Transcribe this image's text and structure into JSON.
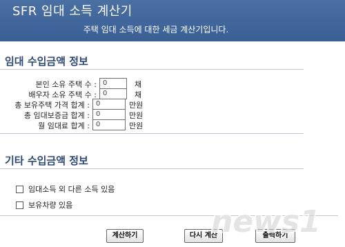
{
  "header": {
    "title": "SFR 임대 소득 계산기",
    "subtitle": "주택 임대 소득에 대한 세금 계산기입니다."
  },
  "section1": {
    "title": "임대 수입금액 정보",
    "rows": [
      {
        "label": "본인 소유 주택 수 :",
        "value": "0",
        "unit": "채"
      },
      {
        "label": "배우자 소유 주택 수 :",
        "value": "0",
        "unit": "채"
      },
      {
        "label": "총 보유주택 가격 합계 :",
        "value": "0",
        "unit": "만원"
      },
      {
        "label": "총 임대보증금 합계 :",
        "value": "0",
        "unit": "만원"
      },
      {
        "label": "월 임대료 합계 :",
        "value": "0",
        "unit": "만원"
      }
    ]
  },
  "section2": {
    "title": "기타 수입금액 정보",
    "checks": [
      {
        "label": "임대소득 외 다른 소득 있음",
        "checked": false
      },
      {
        "label": "보유차량 있음",
        "checked": false
      }
    ]
  },
  "buttons": {
    "calculate": "계산하기",
    "reset": "다시 계산",
    "print": "출력하기"
  },
  "watermark": {
    "text": "news1"
  }
}
